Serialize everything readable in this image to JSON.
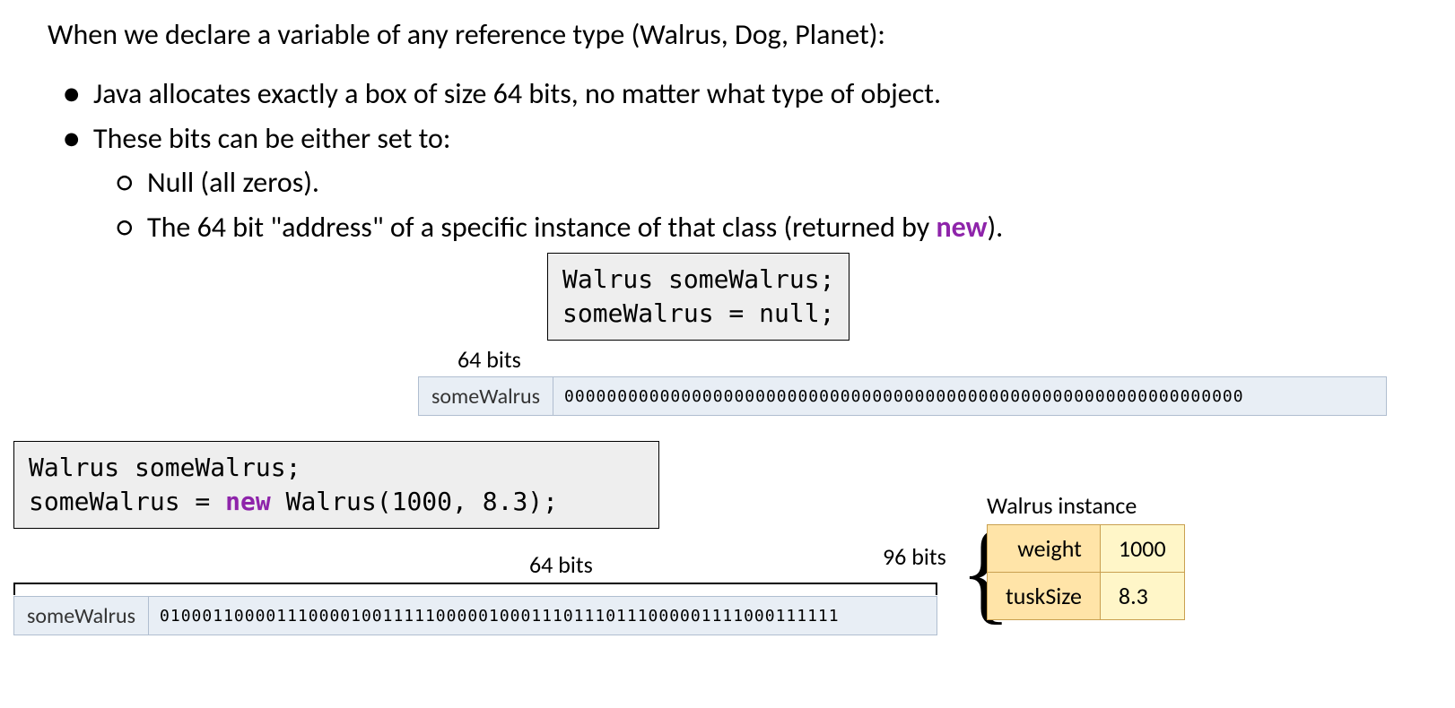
{
  "intro": "When we declare a variable of any reference type (Walrus, Dog, Planet):",
  "bullets": {
    "b1": "Java allocates exactly a box of size 64 bits, no matter what type of object.",
    "b2": "These bits can be either set to:",
    "s1": "Null (all zeros).",
    "s2_pre": "The 64 bit \"address\" of a specific instance of that class (returned by ",
    "s2_kw": "new",
    "s2_post": ")."
  },
  "code1": {
    "line1": "Walrus someWalrus;",
    "line2": "someWalrus = null;"
  },
  "code2": {
    "line1": "Walrus someWalrus;",
    "line2_pre": "someWalrus = ",
    "line2_kw": "new",
    "line2_post": " Walrus(1000, 8.3);"
  },
  "bits": {
    "label64": "64 bits",
    "var": "someWalrus",
    "zeros": "0000000000000000000000000000000000000000000000000000000000000000",
    "addr": "0100011000011100001001111100000100011101110111000001111000111111",
    "label96": "96 bits"
  },
  "instance": {
    "label": "Walrus instance",
    "f1": "weight",
    "v1": "1000",
    "f2": "tuskSize",
    "v2": "8.3"
  }
}
